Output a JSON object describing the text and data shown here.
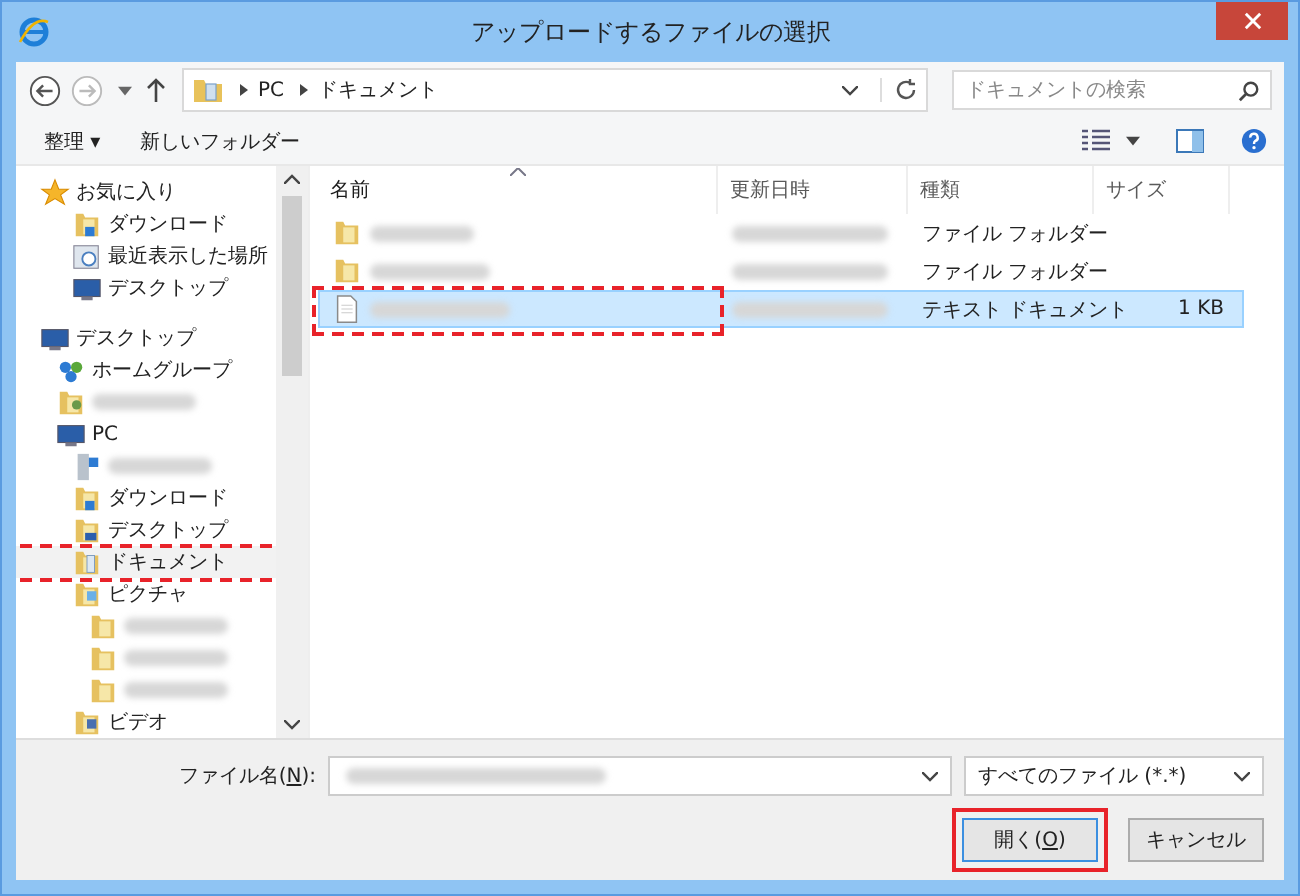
{
  "window": {
    "title": "アップロードするファイルの選択"
  },
  "address": {
    "path": [
      "PC",
      "ドキュメント"
    ],
    "search_placeholder": "ドキュメントの検索"
  },
  "toolbar": {
    "organize": "整理 ▾",
    "new_folder": "新しいフォルダー"
  },
  "sidebar": {
    "sections": [
      {
        "items": [
          {
            "label": "お気に入り",
            "kind": "star",
            "children": [
              {
                "label": "ダウンロード",
                "kind": "downloads"
              },
              {
                "label": "最近表示した場所",
                "kind": "recent"
              },
              {
                "label": "デスクトップ",
                "kind": "desktop"
              }
            ]
          }
        ]
      },
      {
        "items": [
          {
            "label": "デスクトップ",
            "kind": "desktop",
            "children": [
              {
                "label": "ホームグループ",
                "kind": "homegroup"
              },
              {
                "kind": "user"
              },
              {
                "label": "PC",
                "kind": "pc",
                "children": [
                  {
                    "kind": "drive"
                  },
                  {
                    "label": "ダウンロード",
                    "kind": "downloads"
                  },
                  {
                    "label": "デスクトップ",
                    "kind": "desktopfolder"
                  },
                  {
                    "label": "ドキュメント",
                    "kind": "documents",
                    "selected": true,
                    "annotated": true
                  },
                  {
                    "label": "ピクチャ",
                    "kind": "pictures",
                    "children": [
                      {
                        "kind": "folder"
                      },
                      {
                        "kind": "folder"
                      },
                      {
                        "kind": "folder"
                      }
                    ]
                  },
                  {
                    "label": "ビデオ",
                    "kind": "videos"
                  }
                ]
              }
            ]
          }
        ]
      }
    ]
  },
  "columns": [
    {
      "label": "名前",
      "sorted": true
    },
    {
      "label": "更新日時",
      "sorted": false
    },
    {
      "label": "種類",
      "sorted": false
    },
    {
      "label": "サイズ",
      "sorted": false
    }
  ],
  "files": [
    {
      "kind": "folder",
      "type": "ファイル フォルダー",
      "selected": false,
      "annotated": false
    },
    {
      "kind": "folder",
      "type": "ファイル フォルダー",
      "selected": false,
      "annotated": false
    },
    {
      "kind": "textfile",
      "type": "テキスト ドキュメント",
      "size": "1 KB",
      "selected": true,
      "annotated": true
    }
  ],
  "footer": {
    "filename_label": {
      "before": "ファイル名(",
      "key": "N",
      "after": "):"
    },
    "filter": "すべてのファイル (*.*)",
    "open_button": {
      "before": "開く(",
      "key": "O",
      "after": ")",
      "annotated": true
    },
    "cancel_button": "キャンセル"
  }
}
